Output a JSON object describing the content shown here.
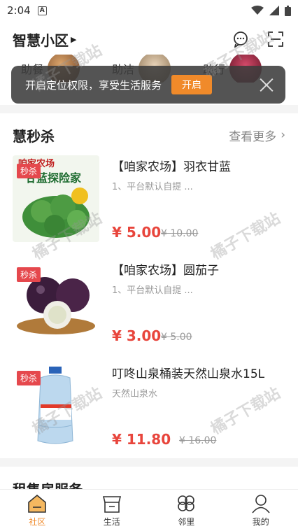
{
  "status": {
    "time": "2:04",
    "notif_letter": "A"
  },
  "header": {
    "title": "智慧小区"
  },
  "services": [
    {
      "label": "助餐"
    },
    {
      "label": "助洁"
    },
    {
      "label": "助行"
    }
  ],
  "toast": {
    "message": "开启定位权限，享受生活服务",
    "button": "开启"
  },
  "flash": {
    "title": "慧秒杀",
    "more": "查看更多",
    "badge": "秒杀",
    "items": [
      {
        "name": "【咱家农场】羽衣甘蓝",
        "desc": "1、平台默认自提 ...",
        "price": "¥ 5.00",
        "orig": "¥ 10.00",
        "img_text": "咱家农场",
        "img_text2": "甘蓝探险家"
      },
      {
        "name": "【咱家农场】圆茄子",
        "desc": "1、平台默认自提 ...",
        "price": "¥ 3.00",
        "orig": "¥ 5.00"
      },
      {
        "name": "叮咚山泉桶装天然山泉水15L",
        "desc": "天然山泉水",
        "price": "¥ 11.80",
        "orig": "¥ 16.00"
      }
    ]
  },
  "next_section": {
    "title": "租售房服务"
  },
  "tabbar": [
    {
      "label": "社区",
      "active": true
    },
    {
      "label": "生活"
    },
    {
      "label": "邻里"
    },
    {
      "label": "我的"
    }
  ],
  "watermark": "橘子下载站",
  "colors": {
    "accent": "#f08a2a",
    "price": "#e8453c",
    "badge": "#e5484d"
  }
}
